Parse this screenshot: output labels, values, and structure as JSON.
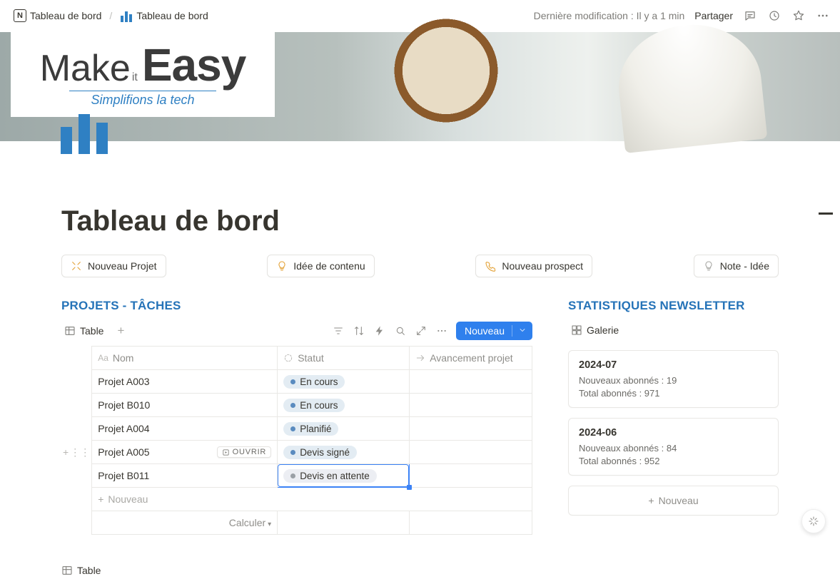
{
  "breadcrumbs": {
    "item1": "Tableau de bord",
    "item2": "Tableau de bord"
  },
  "topbar": {
    "last_modified": "Dernière modification : Il y a 1 min",
    "share": "Partager"
  },
  "brand": {
    "make": "Make",
    "it": "it",
    "easy": "Easy",
    "tagline": "Simplifions la tech"
  },
  "page": {
    "title": "Tableau de bord"
  },
  "quick_buttons": [
    {
      "icon": "collapse",
      "label": "Nouveau Projet"
    },
    {
      "icon": "bulb",
      "label": "Idée de contenu"
    },
    {
      "icon": "phone",
      "label": "Nouveau prospect"
    },
    {
      "icon": "bulb-gray",
      "label": "Note - Idée"
    }
  ],
  "projects": {
    "section_title": "PROJETS - TÂCHES",
    "view_label": "Table",
    "new_button": "Nouveau",
    "columns": {
      "name": "Nom",
      "status": "Statut",
      "progress": "Avancement projet"
    },
    "rows": [
      {
        "name": "Projet A003",
        "status": "En cours",
        "status_tone": "blue"
      },
      {
        "name": "Projet B010",
        "status": "En cours",
        "status_tone": "blue"
      },
      {
        "name": "Projet A004",
        "status": "Planifié",
        "status_tone": "blue"
      },
      {
        "name": "Projet A005",
        "status": "Devis signé",
        "status_tone": "blue",
        "hovered": true,
        "open_label": "OUVRIR"
      },
      {
        "name": "Projet B011",
        "status": "Devis en attente",
        "status_tone": "gray",
        "editing": true
      }
    ],
    "new_row_label": "Nouveau",
    "calculate_label": "Calculer",
    "second_view_label": "Table"
  },
  "newsletter": {
    "section_title": "STATISTIQUES NEWSLETTER",
    "view_label": "Galerie",
    "cards": [
      {
        "title": "2024-07",
        "line1": "Nouveaux abonnés : 19",
        "line2": "Total abonnés : 971"
      },
      {
        "title": "2024-06",
        "line1": "Nouveaux abonnés : 84",
        "line2": "Total abonnés : 952"
      }
    ],
    "new_card_label": "Nouveau"
  }
}
